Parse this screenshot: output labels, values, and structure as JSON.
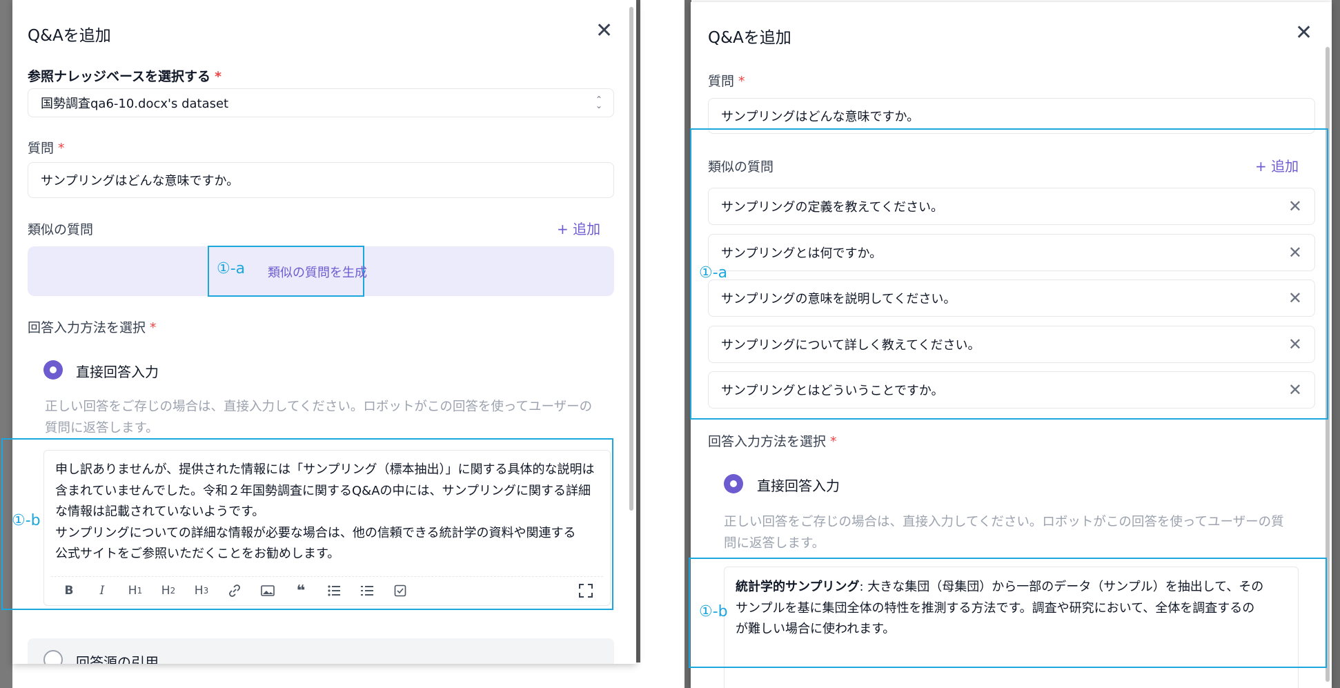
{
  "left_dialog": {
    "title": "Q&Aを追加",
    "kb_label": "参照ナレッジベースを選択する",
    "required_mark": "*",
    "kb_value": "国勢調査qa6-10.docx's dataset",
    "question_label": "質問",
    "question_value": "サンプリングはどんな意味ですか。",
    "similar_label": "類似の質問",
    "add_label": "+ 追加",
    "generate_label": "類似の質問を生成",
    "annotation_a": "①-a",
    "method_label": "回答入力方法を選択",
    "direct_label": "直接回答入力",
    "hint": "正しい回答をご存じの場合は、直接入力してください。ロボットがこの回答を使ってユーザーの質問に返答します。",
    "annotation_b": "①-b",
    "answer_lines": [
      "申し訳ありませんが、提供された情報には「サンプリング（標本抽出）」に関する具体的な説明は",
      "含まれていませんでした。令和２年国勢調査に関するQ&Aの中には、サンプリングに関する詳細",
      "な情報は記載されていないようです。",
      "サンプリングについての詳細な情報が必要な場合は、他の信頼できる統計学の資料や関連する",
      "公式サイトをご参照いただくことをお勧めします。"
    ],
    "source_label": "回答源の引用",
    "toolbar": [
      "B",
      "I",
      "H1",
      "H2",
      "H3",
      "link-icon",
      "image-icon",
      "quote-icon",
      "bullet-list-icon",
      "ordered-list-icon",
      "checkbox-icon",
      "fullscreen-icon"
    ]
  },
  "right_dialog": {
    "title": "Q&Aを追加",
    "question_label": "質問",
    "required_mark": "*",
    "question_value": "サンプリングはどんな意味ですか。",
    "similar_label": "類似の質問",
    "add_label": "+ 追加",
    "similar_questions": [
      "サンプリングの定義を教えてください。",
      "サンプリングとは何ですか。",
      "サンプリングの意味を説明してください。",
      "サンプリングについて詳しく教えてください。",
      "サンプリングとはどういうことですか。"
    ],
    "annotation_a": "①-a",
    "method_label": "回答入力方法を選択",
    "direct_label": "直接回答入力",
    "hint": "正しい回答をご存じの場合は、直接入力してください。ロボットがこの回答を使ってユーザーの質問に返答します。",
    "annotation_b": "①-b",
    "answer_bold": "統計学的サンプリング",
    "answer_rest_1": ": 大きな集団（母集団）から一部のデータ（サンプル）を抽出して、その",
    "answer_line_2": "サンプルを基に集団全体の特性を推測する方法です。調査や研究において、全体を調査するの",
    "answer_line_3": "が難しい場合に使われます。"
  },
  "colors": {
    "accent": "#6d5bd0",
    "annotation": "#1ba7dd",
    "required": "#ef4444"
  }
}
